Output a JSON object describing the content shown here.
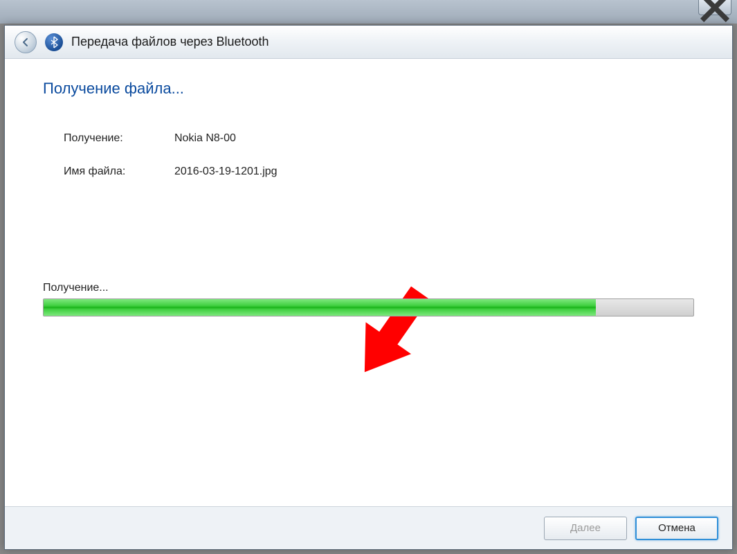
{
  "window": {
    "title": "Передача файлов через Bluetooth",
    "close_tooltip": "Close"
  },
  "heading": "Получение файла...",
  "info": {
    "source_label": "Получение:",
    "source_value": "Nokia N8-00",
    "filename_label": "Имя файла:",
    "filename_value": "2016-03-19-1201.jpg"
  },
  "progress": {
    "label": "Получение...",
    "percent": 85
  },
  "footer": {
    "next_label": "Далее",
    "cancel_label": "Отмена"
  }
}
